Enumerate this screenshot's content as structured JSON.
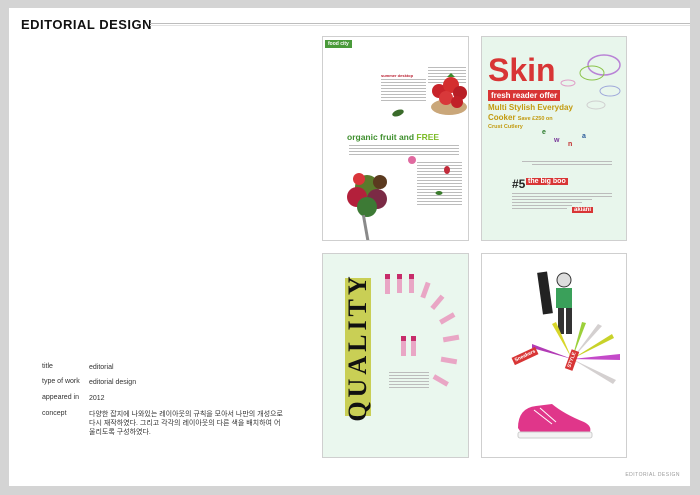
{
  "header": {
    "title": "EDITORIAL DESIGN"
  },
  "info": [
    {
      "label": "title",
      "value": "editorial"
    },
    {
      "label": "type of work",
      "value": "editorial design"
    },
    {
      "label": "appeared in",
      "value": "2012"
    },
    {
      "label": "concept",
      "value": "다양한 잡지에 나와있는 레이아웃의 규칙을 모아서 나만의 개성으로 다시 재작하였다. 그리고 각각의 레이아웃의 다른 색을 배치하여 어울리도록 구성하였다."
    }
  ],
  "spread1": {
    "tag": "food city",
    "headline_main": "organic fruit and ",
    "headline_accent": "FREE",
    "subhead": "summer desktop"
  },
  "spread2": {
    "title": "Skin",
    "banner": "fresh reader offer",
    "line1": "Multi Stylish Everyday",
    "line2_main": "Cooker ",
    "line2_small": "Save £250 on",
    "line3": "Crust Cutlery",
    "issue_number": "#5",
    "issue_label": "the big boo",
    "tag2": "akiani",
    "floating_letters": [
      "e",
      "w",
      "n",
      "a"
    ]
  },
  "spread3": {
    "vertical_word": "QUALITY"
  },
  "spread4": {
    "label1": "Sneakers",
    "label2": "STYLE"
  },
  "footer": {
    "caption": "EDITORIAL DESIGN"
  },
  "colors": {
    "green": "#3f8f2e",
    "red": "#d83535",
    "gold": "#c29a0f",
    "pink": "#e0368a"
  }
}
